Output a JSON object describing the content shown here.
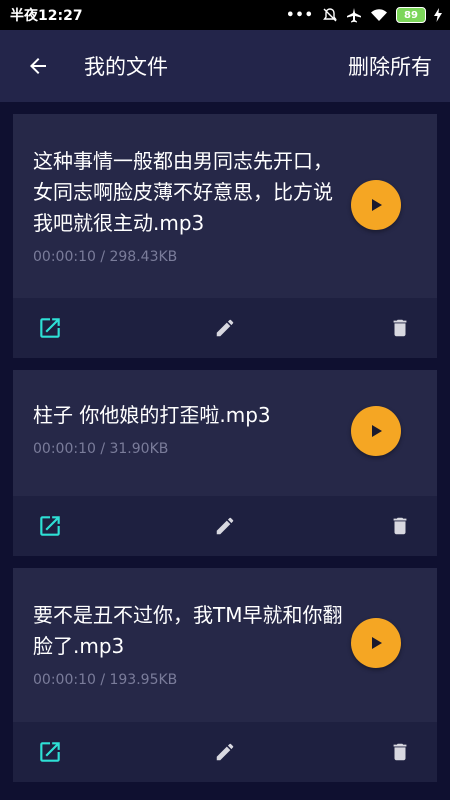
{
  "status_bar": {
    "time": "半夜12:27",
    "dots": "•••",
    "battery": "89"
  },
  "header": {
    "title": "我的文件",
    "delete_all": "删除所有"
  },
  "files": [
    {
      "name": "这种事情一般都由男同志先开口，女同志啊脸皮薄不好意思，比方说我吧就很主动.mp3",
      "meta": "00:00:10 / 298.43KB"
    },
    {
      "name": "柱子 你他娘的打歪啦.mp3",
      "meta": "00:00:10 / 31.90KB"
    },
    {
      "name": "要不是丑不过你，我TM早就和你翻脸了.mp3",
      "meta": "00:00:10 / 193.95KB"
    }
  ],
  "icons": {
    "back": "arrow-left-icon",
    "play": "play-icon",
    "open": "open-external-icon",
    "edit": "pencil-icon",
    "delete": "trash-icon"
  },
  "colors": {
    "accent": "#f5a623",
    "open_icon": "#2ee0d6",
    "card": "#262848",
    "card_actions": "#1e2040",
    "app_bar": "#23254a",
    "background": "#0f1030"
  }
}
